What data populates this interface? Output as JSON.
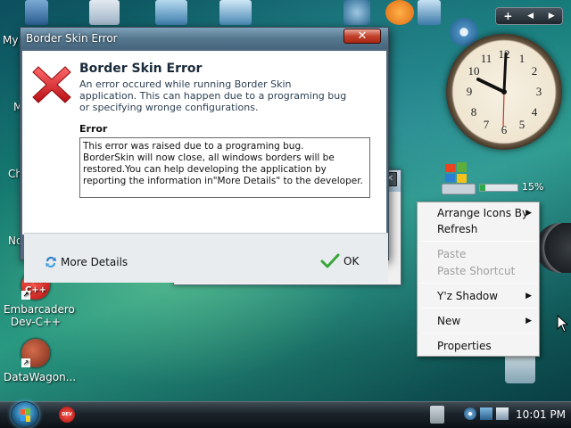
{
  "desktop": {
    "labels": [
      "My",
      "M",
      "Ch",
      "No"
    ],
    "icons": [
      {
        "name": "Embarcadero Dev-C++",
        "line1": "Embarcadero",
        "line2": "Dev-C++",
        "glyph": "DEV C++"
      },
      {
        "name": "DataWagon...",
        "line1": "DataWagon...",
        "line2": ""
      }
    ]
  },
  "sidebar": {
    "controls": {
      "add": "+",
      "prev": "◀",
      "next": "▶"
    },
    "meter_percent": "15%",
    "meter_fraction": 0.15
  },
  "back_dialog": {
    "ok_label": "OK"
  },
  "dialog": {
    "title": "Border Skin Error",
    "close_label": "✕",
    "heading": "Border Skin Error",
    "description": "An error occured while running Border Skin application. This can happen due to a programing bug or specifying wronge configurations.",
    "error_label": "Error",
    "error_text_line1": "This error was raised due to a programing bug.",
    "error_text_line2": "BorderSkin will now close, all windows borders will be restored.You can help developing the application by reporting the information in\"More Details\" to the developer.",
    "more_details": "More Details",
    "ok": "OK"
  },
  "context_menu": {
    "items": [
      {
        "label": "Arrange Icons By",
        "submenu": true,
        "enabled": true
      },
      {
        "label": "Refresh",
        "submenu": false,
        "enabled": true
      },
      {
        "label": "Paste",
        "submenu": false,
        "enabled": false
      },
      {
        "label": "Paste Shortcut",
        "submenu": false,
        "enabled": false
      },
      {
        "label": "Y'z Shadow",
        "submenu": true,
        "enabled": true
      },
      {
        "label": "New",
        "submenu": true,
        "enabled": true
      },
      {
        "label": "Properties",
        "submenu": false,
        "enabled": true
      }
    ],
    "arrow": "▶"
  },
  "taskbar": {
    "time": "10:01 PM",
    "taskbar_app": "DEV C++"
  },
  "colors": {
    "error_red": "#d8202a",
    "ok_green": "#3aa63a",
    "accent_blue": "#2f7fb3"
  }
}
